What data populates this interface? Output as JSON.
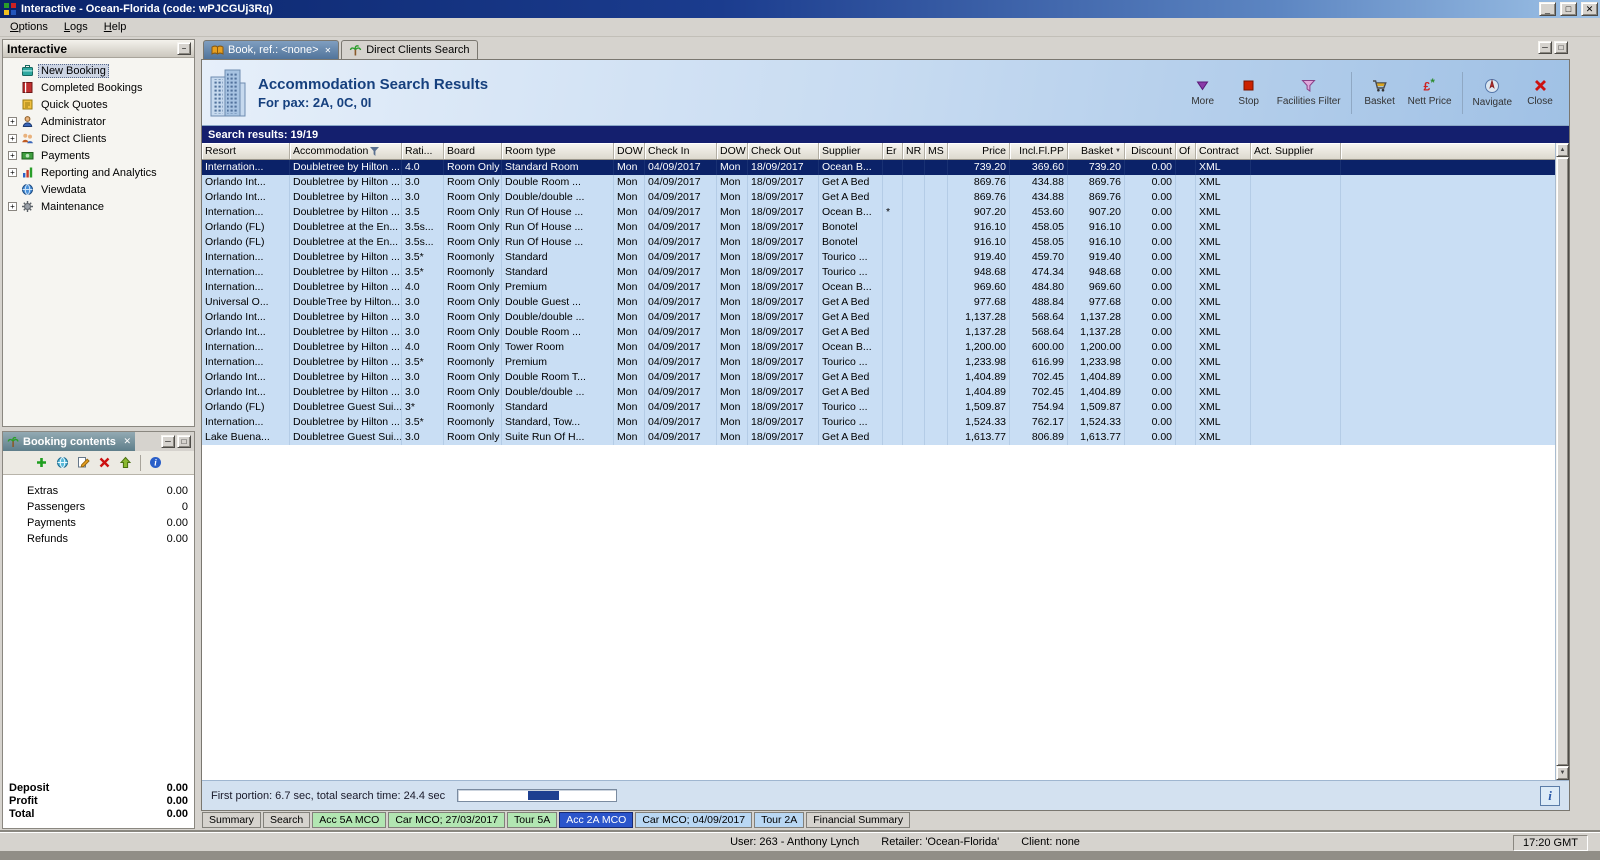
{
  "window": {
    "title": "Interactive - Ocean-Florida (code: wPJCGUj3Rq)",
    "menu": [
      {
        "label": "Options"
      },
      {
        "label": "Logs"
      },
      {
        "label": "Help"
      }
    ],
    "time": "17:20 GMT"
  },
  "sidebar": {
    "title": "Interactive",
    "items": [
      {
        "label": "New Booking",
        "icon": "new-booking-icon",
        "expandable": false,
        "selected": true
      },
      {
        "label": "Completed Bookings",
        "icon": "completed-bookings-icon",
        "expandable": false,
        "selected": false
      },
      {
        "label": "Quick Quotes",
        "icon": "quick-quotes-icon",
        "expandable": false,
        "selected": false
      },
      {
        "label": "Administrator",
        "icon": "administrator-icon",
        "expandable": true,
        "selected": false
      },
      {
        "label": "Direct Clients",
        "icon": "direct-clients-icon",
        "expandable": true,
        "selected": false
      },
      {
        "label": "Payments",
        "icon": "payments-icon",
        "expandable": true,
        "selected": false
      },
      {
        "label": "Reporting and Analytics",
        "icon": "reporting-icon",
        "expandable": true,
        "selected": false
      },
      {
        "label": "Viewdata",
        "icon": "viewdata-icon",
        "expandable": false,
        "selected": false
      },
      {
        "label": "Maintenance",
        "icon": "maintenance-icon",
        "expandable": true,
        "selected": false
      }
    ]
  },
  "booking_contents": {
    "title": "Booking contents",
    "toolbar_icons": [
      "add-icon",
      "globe-icon",
      "edit-icon",
      "delete-icon",
      "up-icon",
      "divider",
      "info-icon"
    ],
    "items": [
      {
        "label": "Extras",
        "value": "0.00"
      },
      {
        "label": "Passengers",
        "value": "0"
      },
      {
        "label": "Payments",
        "value": "0.00"
      },
      {
        "label": "Refunds",
        "value": "0.00"
      }
    ],
    "totals": [
      {
        "label": "Deposit",
        "value": "0.00"
      },
      {
        "label": "Profit",
        "value": "0.00"
      },
      {
        "label": "Total",
        "value": "0.00"
      }
    ]
  },
  "main": {
    "doc_tabs": [
      {
        "label": "Book, ref.: <none>",
        "icon": "book-tab-icon",
        "active": true,
        "closable": true
      },
      {
        "label": "Direct Clients Search",
        "icon": "clients-tab-icon",
        "active": false,
        "closable": false
      }
    ],
    "header": {
      "title": "Accommodation Search Results",
      "subtitle": "For pax: 2A, 0C, 0I"
    },
    "toolbar": [
      {
        "label": "More",
        "icon": "more-icon",
        "group_end": false
      },
      {
        "label": "Stop",
        "icon": "stop-icon",
        "group_end": false
      },
      {
        "label": "Facilities Filter",
        "icon": "facilities-filter-icon",
        "group_end": true
      },
      {
        "label": "Basket",
        "icon": "basket-icon",
        "group_end": false
      },
      {
        "label": "Nett Price",
        "icon": "nett-price-icon",
        "group_end": true
      },
      {
        "label": "Navigate",
        "icon": "navigate-icon",
        "group_end": false
      },
      {
        "label": "Close",
        "icon": "close-icon",
        "group_end": false
      }
    ],
    "results_label": "Search results: 19/19",
    "table": {
      "columns": [
        {
          "label": "Resort"
        },
        {
          "label": "Accommodation",
          "filter": true
        },
        {
          "label": "Rati..."
        },
        {
          "label": "Board"
        },
        {
          "label": "Room type"
        },
        {
          "label": "DOW"
        },
        {
          "label": "Check In"
        },
        {
          "label": "DOW"
        },
        {
          "label": "Check Out"
        },
        {
          "label": "Supplier"
        },
        {
          "label": "Er"
        },
        {
          "label": "NR"
        },
        {
          "label": "MS"
        },
        {
          "label": "Price",
          "align": "right"
        },
        {
          "label": "Incl.Fl.PP",
          "align": "right"
        },
        {
          "label": "Basket",
          "align": "right",
          "sort": true
        },
        {
          "label": "Discount",
          "align": "right"
        },
        {
          "label": "Of"
        },
        {
          "label": "Contract"
        },
        {
          "label": "Act. Supplier"
        }
      ],
      "rows": [
        [
          "Internation...",
          "Doubletree by Hilton ...",
          "4.0",
          "Room Only",
          "Standard Room",
          "Mon",
          "04/09/2017",
          "Mon",
          "18/09/2017",
          "Ocean B...",
          "",
          "",
          "",
          "739.20",
          "369.60",
          "739.20",
          "0.00",
          "",
          "XML",
          ""
        ],
        [
          "Orlando Int...",
          "Doubletree by Hilton ...",
          "3.0",
          "Room Only",
          "Double Room ...",
          "Mon",
          "04/09/2017",
          "Mon",
          "18/09/2017",
          "Get A Bed",
          "",
          "",
          "",
          "869.76",
          "434.88",
          "869.76",
          "0.00",
          "",
          "XML",
          ""
        ],
        [
          "Orlando Int...",
          "Doubletree by Hilton ...",
          "3.0",
          "Room Only",
          "Double/double ...",
          "Mon",
          "04/09/2017",
          "Mon",
          "18/09/2017",
          "Get A Bed",
          "",
          "",
          "",
          "869.76",
          "434.88",
          "869.76",
          "0.00",
          "",
          "XML",
          ""
        ],
        [
          "Internation...",
          "Doubletree by Hilton ...",
          "3.5",
          "Room Only",
          "Run Of House ...",
          "Mon",
          "04/09/2017",
          "Mon",
          "18/09/2017",
          "Ocean B...",
          "*",
          "",
          "",
          "907.20",
          "453.60",
          "907.20",
          "0.00",
          "",
          "XML",
          ""
        ],
        [
          "Orlando (FL)",
          "Doubletree at the En...",
          "3.5s...",
          "Room Only",
          "Run Of House ...",
          "Mon",
          "04/09/2017",
          "Mon",
          "18/09/2017",
          "Bonotel",
          "",
          "",
          "",
          "916.10",
          "458.05",
          "916.10",
          "0.00",
          "",
          "XML",
          ""
        ],
        [
          "Orlando (FL)",
          "Doubletree at the En...",
          "3.5s...",
          "Room Only",
          "Run Of House ...",
          "Mon",
          "04/09/2017",
          "Mon",
          "18/09/2017",
          "Bonotel",
          "",
          "",
          "",
          "916.10",
          "458.05",
          "916.10",
          "0.00",
          "",
          "XML",
          ""
        ],
        [
          "Internation...",
          "Doubletree by Hilton ...",
          "3.5*",
          "Roomonly",
          "Standard",
          "Mon",
          "04/09/2017",
          "Mon",
          "18/09/2017",
          "Tourico ...",
          "",
          "",
          "",
          "919.40",
          "459.70",
          "919.40",
          "0.00",
          "",
          "XML",
          ""
        ],
        [
          "Internation...",
          "Doubletree by Hilton ...",
          "3.5*",
          "Roomonly",
          "Standard",
          "Mon",
          "04/09/2017",
          "Mon",
          "18/09/2017",
          "Tourico ...",
          "",
          "",
          "",
          "948.68",
          "474.34",
          "948.68",
          "0.00",
          "",
          "XML",
          ""
        ],
        [
          "Internation...",
          "Doubletree by Hilton ...",
          "4.0",
          "Room Only",
          "Premium",
          "Mon",
          "04/09/2017",
          "Mon",
          "18/09/2017",
          "Ocean B...",
          "",
          "",
          "",
          "969.60",
          "484.80",
          "969.60",
          "0.00",
          "",
          "XML",
          ""
        ],
        [
          "Universal O...",
          "DoubleTree by Hilton...",
          "3.0",
          "Room Only",
          "Double Guest ...",
          "Mon",
          "04/09/2017",
          "Mon",
          "18/09/2017",
          "Get A Bed",
          "",
          "",
          "",
          "977.68",
          "488.84",
          "977.68",
          "0.00",
          "",
          "XML",
          ""
        ],
        [
          "Orlando Int...",
          "Doubletree by Hilton ...",
          "3.0",
          "Room Only",
          "Double/double ...",
          "Mon",
          "04/09/2017",
          "Mon",
          "18/09/2017",
          "Get A Bed",
          "",
          "",
          "",
          "1,137.28",
          "568.64",
          "1,137.28",
          "0.00",
          "",
          "XML",
          ""
        ],
        [
          "Orlando Int...",
          "Doubletree by Hilton ...",
          "3.0",
          "Room Only",
          "Double Room ...",
          "Mon",
          "04/09/2017",
          "Mon",
          "18/09/2017",
          "Get A Bed",
          "",
          "",
          "",
          "1,137.28",
          "568.64",
          "1,137.28",
          "0.00",
          "",
          "XML",
          ""
        ],
        [
          "Internation...",
          "Doubletree by Hilton ...",
          "4.0",
          "Room Only",
          "Tower Room",
          "Mon",
          "04/09/2017",
          "Mon",
          "18/09/2017",
          "Ocean B...",
          "",
          "",
          "",
          "1,200.00",
          "600.00",
          "1,200.00",
          "0.00",
          "",
          "XML",
          ""
        ],
        [
          "Internation...",
          "Doubletree by Hilton ...",
          "3.5*",
          "Roomonly",
          "Premium",
          "Mon",
          "04/09/2017",
          "Mon",
          "18/09/2017",
          "Tourico ...",
          "",
          "",
          "",
          "1,233.98",
          "616.99",
          "1,233.98",
          "0.00",
          "",
          "XML",
          ""
        ],
        [
          "Orlando Int...",
          "Doubletree by Hilton ...",
          "3.0",
          "Room Only",
          "Double Room T...",
          "Mon",
          "04/09/2017",
          "Mon",
          "18/09/2017",
          "Get A Bed",
          "",
          "",
          "",
          "1,404.89",
          "702.45",
          "1,404.89",
          "0.00",
          "",
          "XML",
          ""
        ],
        [
          "Orlando Int...",
          "Doubletree by Hilton ...",
          "3.0",
          "Room Only",
          "Double/double ...",
          "Mon",
          "04/09/2017",
          "Mon",
          "18/09/2017",
          "Get A Bed",
          "",
          "",
          "",
          "1,404.89",
          "702.45",
          "1,404.89",
          "0.00",
          "",
          "XML",
          ""
        ],
        [
          "Orlando (FL)",
          "Doubletree Guest Sui...",
          "3*",
          "Roomonly",
          "Standard",
          "Mon",
          "04/09/2017",
          "Mon",
          "18/09/2017",
          "Tourico ...",
          "",
          "",
          "",
          "1,509.87",
          "754.94",
          "1,509.87",
          "0.00",
          "",
          "XML",
          ""
        ],
        [
          "Internation...",
          "Doubletree by Hilton ...",
          "3.5*",
          "Roomonly",
          "Standard, Tow...",
          "Mon",
          "04/09/2017",
          "Mon",
          "18/09/2017",
          "Tourico ...",
          "",
          "",
          "",
          "1,524.33",
          "762.17",
          "1,524.33",
          "0.00",
          "",
          "XML",
          ""
        ],
        [
          "Lake Buena...",
          "Doubletree Guest Sui...",
          "3.0",
          "Room Only",
          "Suite Run Of H...",
          "Mon",
          "04/09/2017",
          "Mon",
          "18/09/2017",
          "Get A Bed",
          "",
          "",
          "",
          "1,613.77",
          "806.89",
          "1,613.77",
          "0.00",
          "",
          "XML",
          ""
        ]
      ]
    },
    "status_text": "First portion: 6.7 sec, total search time: 24.4 sec",
    "info_label": "i",
    "bottom_tabs": [
      {
        "label": "Summary",
        "style": "plain"
      },
      {
        "label": "Search",
        "style": "plain"
      },
      {
        "label": "Acc 5A MCO",
        "style": "green"
      },
      {
        "label": "Car MCO; 27/03/2017",
        "style": "green"
      },
      {
        "label": "Tour 5A",
        "style": "green"
      },
      {
        "label": "Acc 2A MCO",
        "style": "selected"
      },
      {
        "label": "Car MCO; 04/09/2017",
        "style": "blue"
      },
      {
        "label": "Tour 2A",
        "style": "blue"
      },
      {
        "label": "Financial Summary",
        "style": "plain"
      }
    ],
    "colors": {
      "row": "#c9def4",
      "selected_row": "#0b2268",
      "results_bar": "#141f6e",
      "selected_tab": "#2b55cb"
    }
  },
  "statusbar": {
    "user": "User: 263 - Anthony Lynch",
    "retailer": "Retailer: 'Ocean-Florida'",
    "client": "Client: none"
  }
}
